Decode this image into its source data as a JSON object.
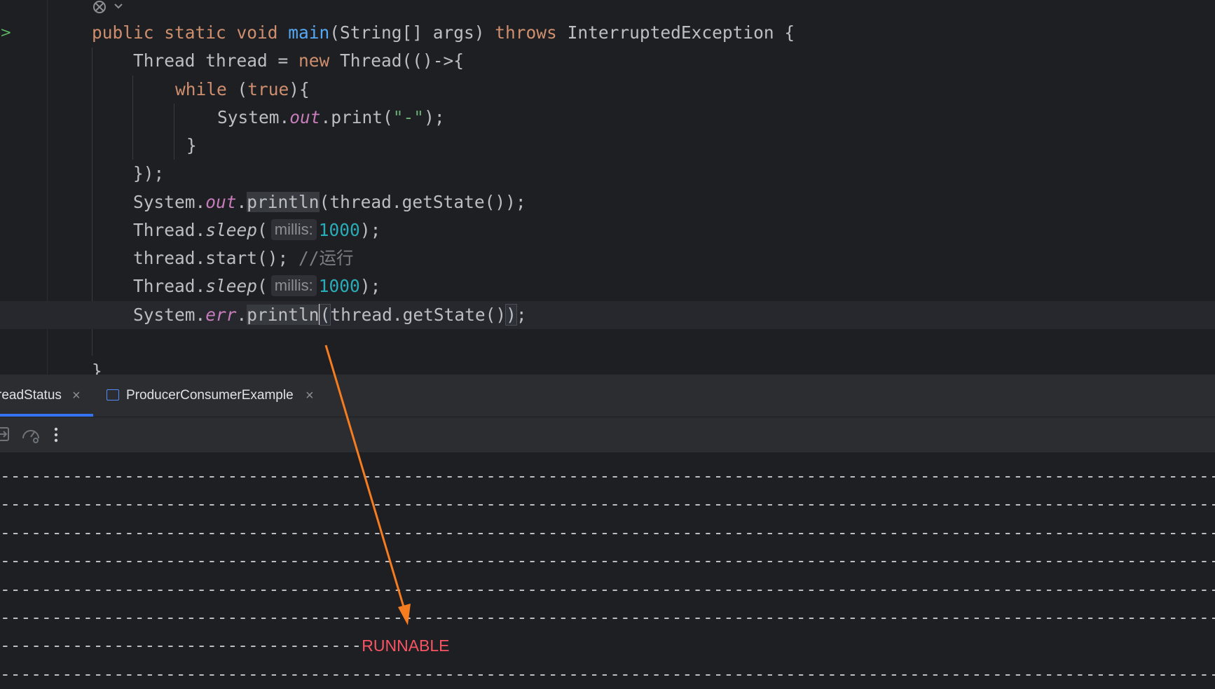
{
  "editor": {
    "lines": [
      {
        "segments": [
          [
            "kw",
            "public static void "
          ],
          [
            "fn",
            "main"
          ],
          [
            "",
            "(String[] args) "
          ],
          [
            "kw",
            "throws"
          ],
          [
            "",
            " InterruptedException {"
          ]
        ]
      },
      {
        "segments": [
          [
            "",
            "Thread thread = "
          ],
          [
            "kw",
            "new"
          ],
          [
            "",
            " Thread(()->{"
          ]
        ]
      },
      {
        "segments": [
          [
            "kw",
            "while"
          ],
          [
            "",
            " ("
          ],
          [
            "kw",
            "true"
          ],
          [
            "",
            "){"
          ]
        ]
      },
      {
        "segments": [
          [
            "",
            "System."
          ],
          [
            "st",
            "out"
          ],
          [
            "",
            ".print("
          ],
          [
            "str",
            "\"-\""
          ],
          [
            "",
            ");"
          ]
        ]
      },
      {
        "segments": [
          [
            "",
            "}"
          ]
        ]
      },
      {
        "segments": [
          [
            "",
            "});"
          ]
        ]
      },
      {
        "segments": [
          [
            "",
            "System."
          ],
          [
            "st",
            "out"
          ],
          [
            "",
            "."
          ],
          [
            "hl",
            "println"
          ],
          [
            "",
            "(thread.getState());"
          ]
        ]
      },
      {
        "segments": [
          [
            "",
            "Thread."
          ],
          [
            "sm",
            "sleep"
          ],
          [
            "",
            "("
          ],
          [
            "hint",
            "millis:"
          ],
          [
            "num",
            "1000"
          ],
          [
            "",
            ");"
          ]
        ]
      },
      {
        "segments": [
          [
            "",
            "thread.start(); "
          ],
          [
            "cmt",
            "//"
          ],
          [
            "cmt cjk",
            "运行"
          ]
        ]
      },
      {
        "segments": [
          [
            "",
            "Thread."
          ],
          [
            "sm",
            "sleep"
          ],
          [
            "",
            "("
          ],
          [
            "hint",
            "millis:"
          ],
          [
            "num",
            "1000"
          ],
          [
            "",
            ");"
          ]
        ]
      },
      {
        "segments": [
          [
            "",
            "System."
          ],
          [
            "st",
            "err"
          ],
          [
            "",
            "."
          ],
          [
            "hl",
            "println"
          ],
          [
            "caret",
            ""
          ],
          [
            "brk",
            "("
          ],
          [
            "",
            "thread.getState()"
          ],
          [
            "brk",
            ")"
          ],
          [
            "",
            ";"
          ]
        ]
      },
      {
        "segments": []
      },
      {
        "segments": [
          [
            "",
            "}"
          ]
        ]
      }
    ]
  },
  "run": {
    "tabs": [
      {
        "label": "readStatus",
        "active": true
      },
      {
        "label": "ProducerConsumerExample",
        "active": false
      }
    ],
    "close_glyph": "×",
    "toolbar_icons": [
      "restore-layout-icon",
      "profiler-icon",
      "more-options-icon"
    ]
  },
  "console": {
    "dash_count": 210,
    "lines": [
      {
        "dashes": 210,
        "err": ""
      },
      {
        "dashes": 210,
        "err": ""
      },
      {
        "dashes": 210,
        "err": ""
      },
      {
        "dashes": 210,
        "err": ""
      },
      {
        "dashes": 210,
        "err": ""
      },
      {
        "dashes": 210,
        "err": ""
      },
      {
        "dashes": 35,
        "err": "RUNNABLE"
      },
      {
        "dashes": 210,
        "err": ""
      }
    ]
  },
  "colors": {
    "annotation_arrow": "#f57c1f",
    "stderr": "#f75464",
    "accent": "#3574f0"
  }
}
